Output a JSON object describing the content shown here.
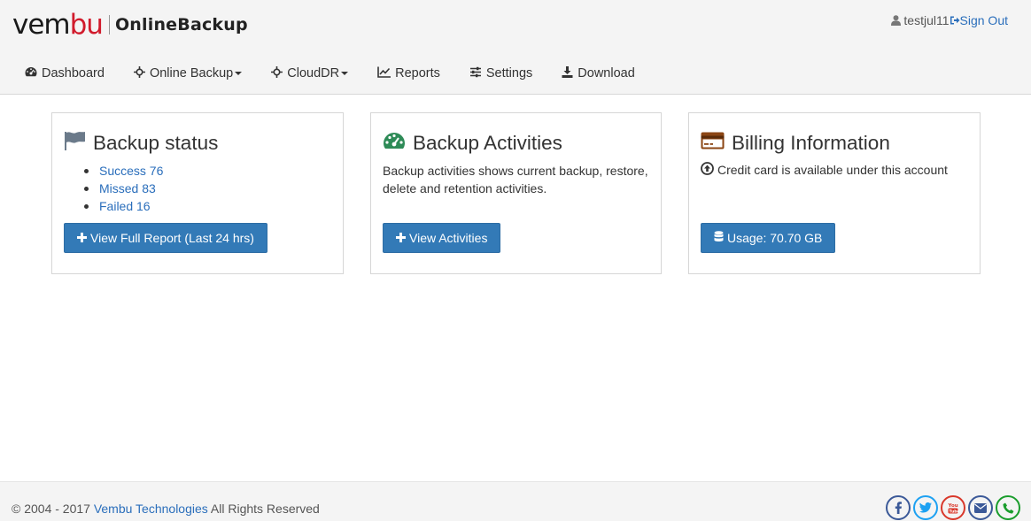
{
  "header": {
    "logo": {
      "part1": "vem",
      "part2": "bu",
      "product": "OnlineBackup"
    },
    "user": {
      "name": "testjul11",
      "signout_label": "Sign Out"
    }
  },
  "nav": {
    "items": [
      {
        "label": "Dashboard",
        "icon": "dashboard-icon",
        "dropdown": false
      },
      {
        "label": "Online Backup",
        "icon": "crosshair-icon",
        "dropdown": true
      },
      {
        "label": "CloudDR",
        "icon": "crosshair-icon",
        "dropdown": true
      },
      {
        "label": "Reports",
        "icon": "line-chart-icon",
        "dropdown": false
      },
      {
        "label": "Settings",
        "icon": "sliders-icon",
        "dropdown": false
      },
      {
        "label": "Download",
        "icon": "download-icon",
        "dropdown": false
      }
    ]
  },
  "panels": {
    "backup_status": {
      "title": "Backup status",
      "items": [
        "Success 76",
        "Missed 83",
        "Failed 16"
      ],
      "button": "View Full Report (Last 24 hrs)"
    },
    "backup_activities": {
      "title": "Backup Activities",
      "description": "Backup activities shows current backup, restore, delete and retention activities.",
      "button": "View Activities"
    },
    "billing": {
      "title": "Billing Information",
      "info": "Credit card is available under this account",
      "button": "Usage: 70.70 GB"
    }
  },
  "footer": {
    "copyright_prefix": "© 2004 - 2017",
    "company": "Vembu Technologies",
    "copyright_suffix": "All Rights Reserved",
    "socials": [
      {
        "name": "facebook-icon",
        "color": "#3b5998"
      },
      {
        "name": "twitter-icon",
        "color": "#1da1f2"
      },
      {
        "name": "youtube-icon",
        "color": "#d9382b"
      },
      {
        "name": "email-icon",
        "color": "#3b5998"
      },
      {
        "name": "phone-icon",
        "color": "#1a9d2c"
      }
    ]
  },
  "colors": {
    "link": "#2a6ebb",
    "button": "#337ab7",
    "brand_red": "#d11b2c",
    "activities_icon": "#2e8b57",
    "billing_icon": "#8b4513",
    "flag_icon": "#6b7a8a"
  }
}
